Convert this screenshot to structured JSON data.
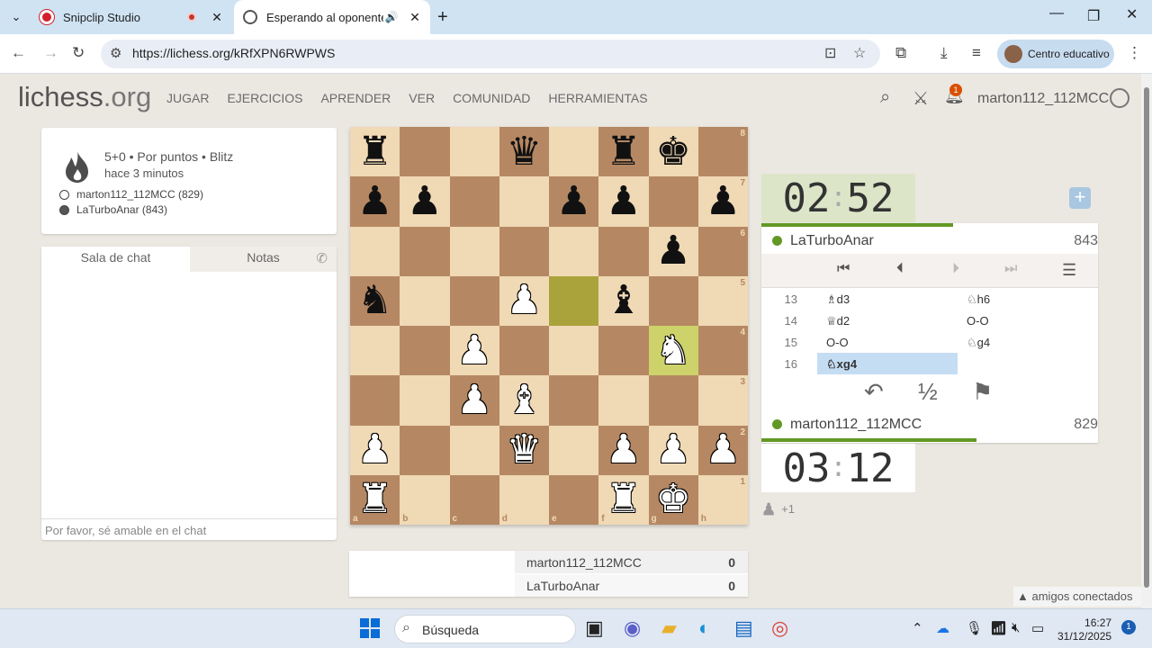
{
  "browser": {
    "tabs": [
      {
        "title": "Snipclip Studio",
        "active": false
      },
      {
        "title": "Esperando al oponente - Juega",
        "active": true
      }
    ],
    "url": "https://lichess.org/kRfXPN6RWPWS",
    "profile_label": "Centro educativo"
  },
  "site": {
    "logo_main": "lichess",
    "logo_suffix": ".org",
    "nav": [
      "JUGAR",
      "EJERCICIOS",
      "APRENDER",
      "VER",
      "COMUNIDAD",
      "HERRAMIENTAS"
    ],
    "notification_count": "1",
    "username": "marton112_112MCC"
  },
  "game_info": {
    "setup": "5+0 • Por puntos • Blitz",
    "ago": "hace 3 minutos",
    "white_player": "marton112_112MCC (829)",
    "black_player": "LaTurboAnar (843)"
  },
  "chat": {
    "tab_chat": "Sala de chat",
    "tab_notes": "Notas",
    "placeholder": "Por favor, sé amable en el chat"
  },
  "board": {
    "ranks": [
      "8",
      "7",
      "6",
      "5",
      "4",
      "3",
      "2",
      "1"
    ],
    "files": [
      "a",
      "b",
      "c",
      "d",
      "e",
      "f",
      "g",
      "h"
    ],
    "position": [
      [
        "r",
        "",
        "",
        "q",
        "",
        "r",
        "k",
        ""
      ],
      [
        "p",
        "p",
        "",
        "",
        "p",
        "p",
        "",
        "p"
      ],
      [
        "",
        "",
        "",
        "",
        "",
        "",
        "p",
        ""
      ],
      [
        "n",
        "",
        "",
        "P",
        "",
        "b",
        "",
        ""
      ],
      [
        "",
        "",
        "P",
        "",
        "",
        "",
        "N",
        ""
      ],
      [
        "",
        "",
        "P",
        "B",
        "",
        "",
        "",
        ""
      ],
      [
        "P",
        "",
        "",
        "Q",
        "",
        "P",
        "P",
        "P"
      ],
      [
        "R",
        "",
        "",
        "",
        "",
        "R",
        "K",
        ""
      ]
    ],
    "highlight": [
      "e5",
      "g4"
    ]
  },
  "clocks": {
    "top": {
      "min": "02",
      "sec": "52"
    },
    "bottom": {
      "min": "03",
      "sec": "12"
    }
  },
  "top_player": {
    "name": "LaTurboAnar",
    "rating": "843",
    "time_fraction": 0.57
  },
  "bottom_player": {
    "name": "marton112_112MCC",
    "rating": "829",
    "time_fraction": 0.64
  },
  "moves": [
    {
      "n": "13",
      "w": "♗d3",
      "b": "♘h6"
    },
    {
      "n": "14",
      "w": "♕d2",
      "b": "O-O"
    },
    {
      "n": "15",
      "w": "O-O",
      "b": "♘g4"
    },
    {
      "n": "16",
      "w": "♘xg4",
      "b": ""
    }
  ],
  "game_controls": {
    "takeback": "↶",
    "draw": "½",
    "resign": "⚑"
  },
  "spectators": "+1",
  "crosstable": [
    {
      "name": "marton112_112MCC",
      "score": "0"
    },
    {
      "name": "LaTurboAnar",
      "score": "0"
    }
  ],
  "friends": "amigos conectados",
  "taskbar": {
    "search_placeholder": "Búsqueda",
    "time": "16:27",
    "date": "31/12/2025",
    "notifications": "1"
  }
}
